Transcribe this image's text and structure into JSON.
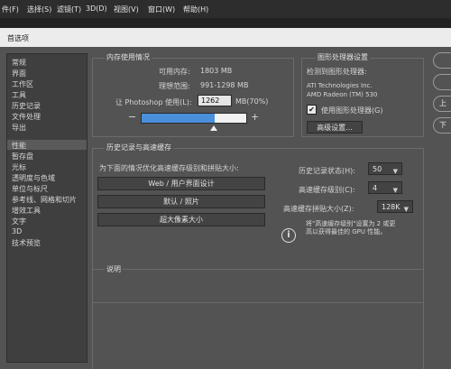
{
  "menubar": {
    "items": [
      "件(F)",
      "选择(S)",
      "滤镜(T)",
      "3D(D)",
      "视图(V)",
      "窗口(W)",
      "帮助(H)"
    ]
  },
  "dialog": {
    "title": "首选项"
  },
  "sidebar": {
    "items": [
      "常规",
      "界面",
      "工作区",
      "工具",
      "历史记录",
      "文件处理",
      "导出",
      "性能",
      "暂存盘",
      "光标",
      "透明度与色域",
      "单位与标尺",
      "参考线、网格和切片",
      "增效工具",
      "文字",
      "3D",
      "技术预览"
    ],
    "selected": "性能"
  },
  "memory": {
    "legend": "内存使用情况",
    "available_label": "可用内存:",
    "available_value": "1803 MB",
    "ideal_label": "理想范围:",
    "ideal_value": "991-1298 MB",
    "let_label": "让 Photoshop 使用(L):",
    "let_value": "1262",
    "let_unit": "MB(70%)",
    "minus": "−",
    "plus": "+",
    "slider_fraction": 0.7
  },
  "gpu": {
    "legend": "图形处理器设置",
    "detected_label": "检测到图形处理器:",
    "vendor": "ATI Technologies Inc.",
    "model": "AMD Radeon (TM) 530",
    "use_gpu_label": "使用图形处理器(G)",
    "use_gpu_checked": true,
    "check_mark": "✔",
    "advanced_button": "高级设置..."
  },
  "history_cache": {
    "legend": "历史记录与高速缓存",
    "prompt": "为下面的情况优化高速缓存级别和拼贴大小:",
    "buttons": [
      "Web / 用户界面设计",
      "默认 / 照片",
      "超大像素大小"
    ],
    "history_states_label": "历史记录状态(H):",
    "history_states_value": "50",
    "cache_levels_label": "高速缓存级别(C):",
    "cache_levels_value": "4",
    "tile_size_label": "高速缓存拼贴大小(Z):",
    "tile_size_value": "128K",
    "info_text_line1": "将\"高速缓存级别\"设置为 2 或更",
    "info_text_line2": "高以获得最佳的 GPU 性能。",
    "info_icon_glyph": "i"
  },
  "description": {
    "legend": "说明"
  },
  "right_buttons": [
    "",
    "",
    "上",
    "下"
  ]
}
